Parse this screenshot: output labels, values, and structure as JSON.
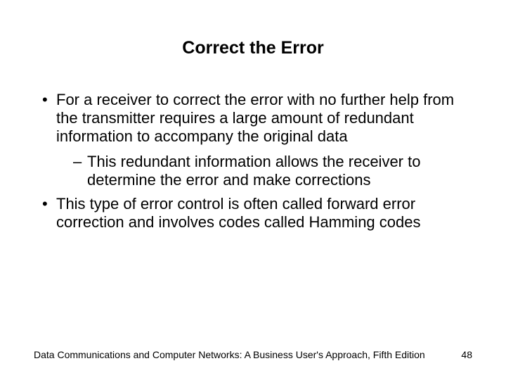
{
  "slide": {
    "title": "Correct the Error",
    "bullets": [
      {
        "text": "For a receiver to correct the error with no further help from the transmitter requires a large amount of redundant information to accompany the original data",
        "sub": [
          "This redundant information allows the receiver to determine the error and make corrections"
        ]
      },
      {
        "text": "This type of error control is often called forward error correction and involves codes called Hamming codes",
        "sub": []
      }
    ],
    "footer": {
      "source": "Data Communications and Computer Networks: A Business User's Approach, Fifth Edition",
      "page": "48"
    }
  }
}
